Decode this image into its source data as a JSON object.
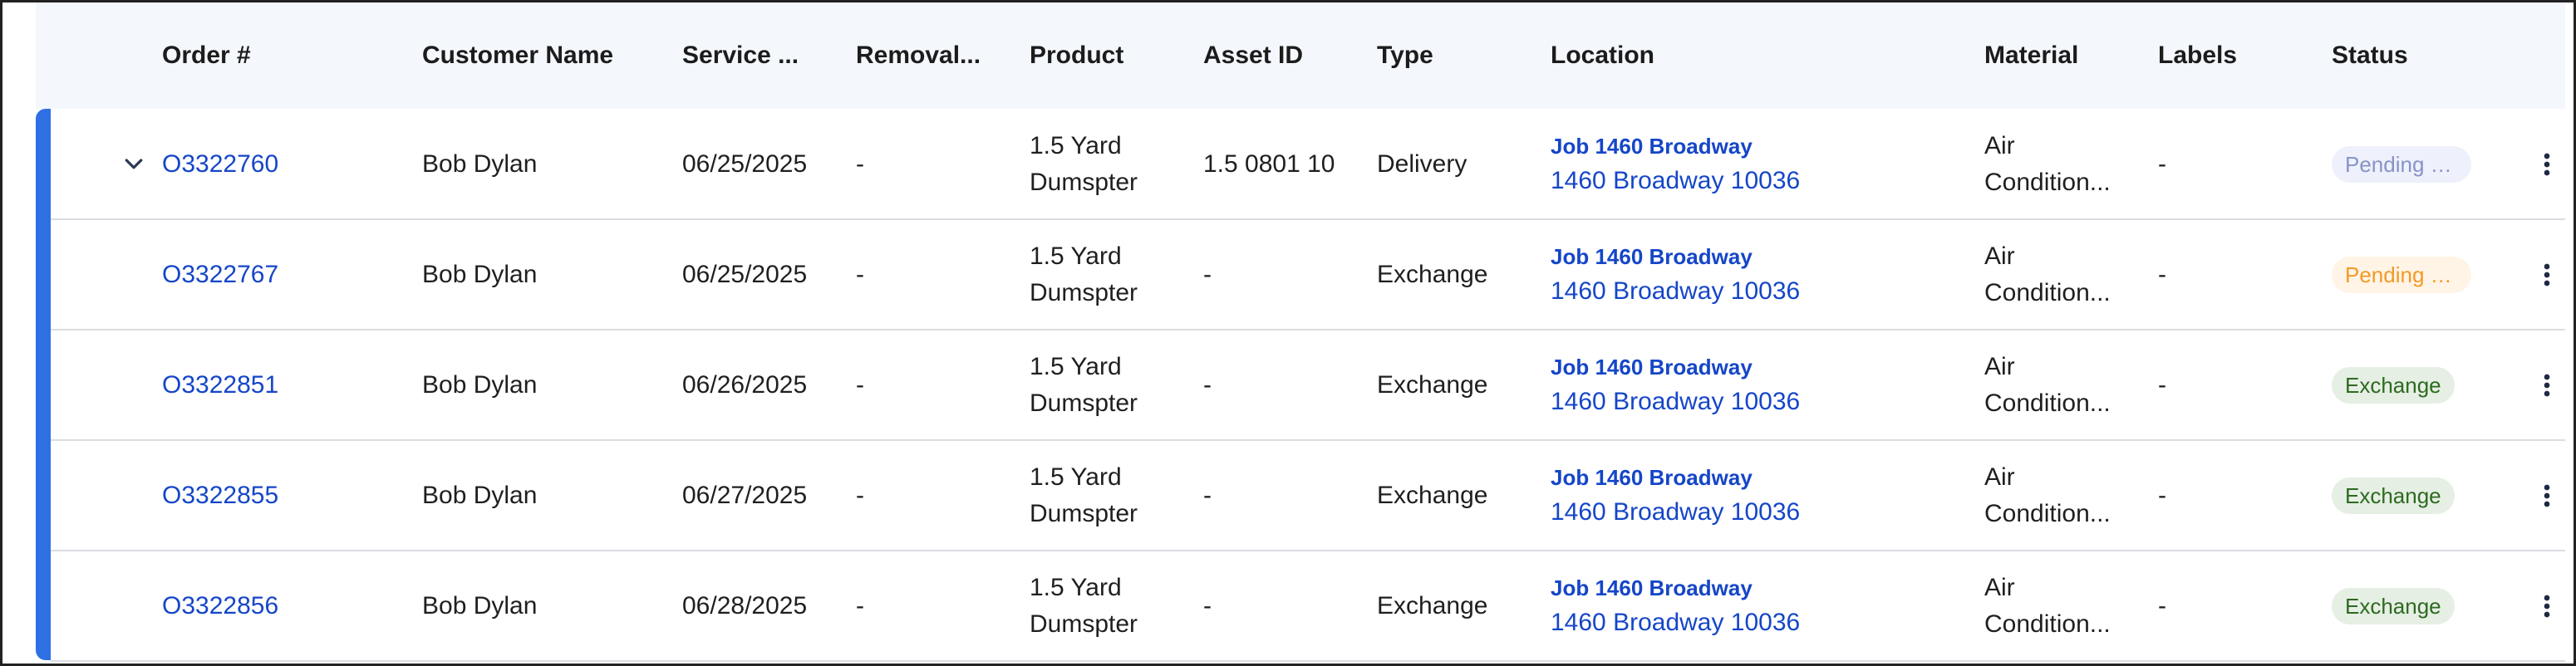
{
  "columns": {
    "order": "Order #",
    "customer": "Customer Name",
    "service": "Service ...",
    "removal": "Removal...",
    "product": "Product",
    "asset": "Asset ID",
    "type": "Type",
    "location": "Location",
    "material": "Material",
    "labels": "Labels",
    "status": "Status"
  },
  "rows": [
    {
      "order": "O3322760",
      "customer": "Bob Dylan",
      "service": "06/25/2025",
      "removal": "-",
      "product_line1": "1.5 Yard",
      "product_line2": "Dumspter",
      "asset": "1.5 0801 10",
      "type": "Delivery",
      "location_job": "Job 1460 Broadway",
      "location_address": "1460 Broadway 10036",
      "material_line1": "Air",
      "material_line2": "Condition...",
      "labels": "-",
      "status": "Pending R...",
      "status_kind": "pending-r",
      "expandable": true
    },
    {
      "order": "O3322767",
      "customer": "Bob Dylan",
      "service": "06/25/2025",
      "removal": "-",
      "product_line1": "1.5 Yard",
      "product_line2": "Dumspter",
      "asset": "-",
      "type": "Exchange",
      "location_job": "Job 1460 Broadway",
      "location_address": "1460 Broadway 10036",
      "material_line1": "Air",
      "material_line2": "Condition...",
      "labels": "-",
      "status": "Pending D...",
      "status_kind": "pending-d",
      "expandable": false
    },
    {
      "order": "O3322851",
      "customer": "Bob Dylan",
      "service": "06/26/2025",
      "removal": "-",
      "product_line1": "1.5 Yard",
      "product_line2": "Dumspter",
      "asset": "-",
      "type": "Exchange",
      "location_job": "Job 1460 Broadway",
      "location_address": "1460 Broadway 10036",
      "material_line1": "Air",
      "material_line2": "Condition...",
      "labels": "-",
      "status": "Exchange",
      "status_kind": "exchange",
      "expandable": false
    },
    {
      "order": "O3322855",
      "customer": "Bob Dylan",
      "service": "06/27/2025",
      "removal": "-",
      "product_line1": "1.5 Yard",
      "product_line2": "Dumspter",
      "asset": "-",
      "type": "Exchange",
      "location_job": "Job 1460 Broadway",
      "location_address": "1460 Broadway 10036",
      "material_line1": "Air",
      "material_line2": "Condition...",
      "labels": "-",
      "status": "Exchange",
      "status_kind": "exchange",
      "expandable": false
    },
    {
      "order": "O3322856",
      "customer": "Bob Dylan",
      "service": "06/28/2025",
      "removal": "-",
      "product_line1": "1.5 Yard",
      "product_line2": "Dumspter",
      "asset": "-",
      "type": "Exchange",
      "location_job": "Job 1460 Broadway",
      "location_address": "1460 Broadway 10036",
      "material_line1": "Air",
      "material_line2": "Condition...",
      "labels": "-",
      "status": "Exchange",
      "status_kind": "exchange",
      "expandable": false
    }
  ],
  "icons": {
    "expand": "chevron-down-icon",
    "row_menu": "more-vertical-icon"
  },
  "colors": {
    "accent": "#2f6fe4",
    "link": "#1546c8",
    "header_bg": "#f4f8fd"
  }
}
